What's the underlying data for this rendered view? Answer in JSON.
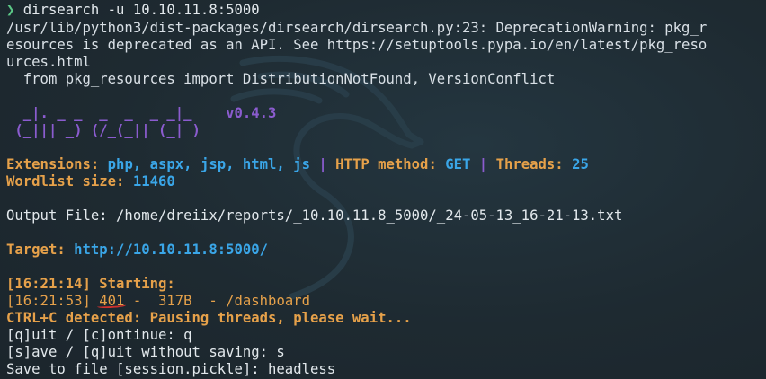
{
  "terminal": {
    "prompt_symbol": "❯",
    "command": "dirsearch -u 10.10.11.8:5000",
    "warning_lines": [
      "/usr/lib/python3/dist-packages/dirsearch/dirsearch.py:23: DeprecationWarning: pkg_r",
      "esources is deprecated as an API. See https://setuptools.pypa.io/en/latest/pkg_reso",
      "urces.html",
      "  from pkg_resources import DistributionNotFound, VersionConflict"
    ],
    "banner": {
      "line1": "  _|. _ _  _  _  _ _|_    ",
      "line2": " (_||| _) (/_(_|| (_| )",
      "version": "v0.4.3"
    },
    "config": {
      "extensions_label": "Extensions: ",
      "extensions_value": "php, aspx, jsp, html, js",
      "sep1": " | ",
      "http_method_label": "HTTP method: ",
      "http_method_value": "GET",
      "sep2": " | ",
      "threads_label": "Threads: ",
      "threads_value": "25",
      "wordlist_label": "Wordlist size: ",
      "wordlist_value": "11460"
    },
    "output_file_line": "Output File: /home/dreiix/reports/_10.10.11.8_5000/_24-05-13_16-21-13.txt",
    "target": {
      "label": "Target: ",
      "value": "http://10.10.11.8:5000/"
    },
    "starting": "[16:21:14] Starting:",
    "result": {
      "timestamp": "[16:21:53] ",
      "status": "401",
      "rest": " -  317B  - /dashboard"
    },
    "ctrl_c": "CTRL+C detected: Pausing threads, please wait...",
    "prompt_continue": "[q]uit / [c]ontinue: q",
    "prompt_save": "[s]ave / [q]uit without saving: s",
    "prompt_file": "Save to file [session.pickle]: headless"
  }
}
